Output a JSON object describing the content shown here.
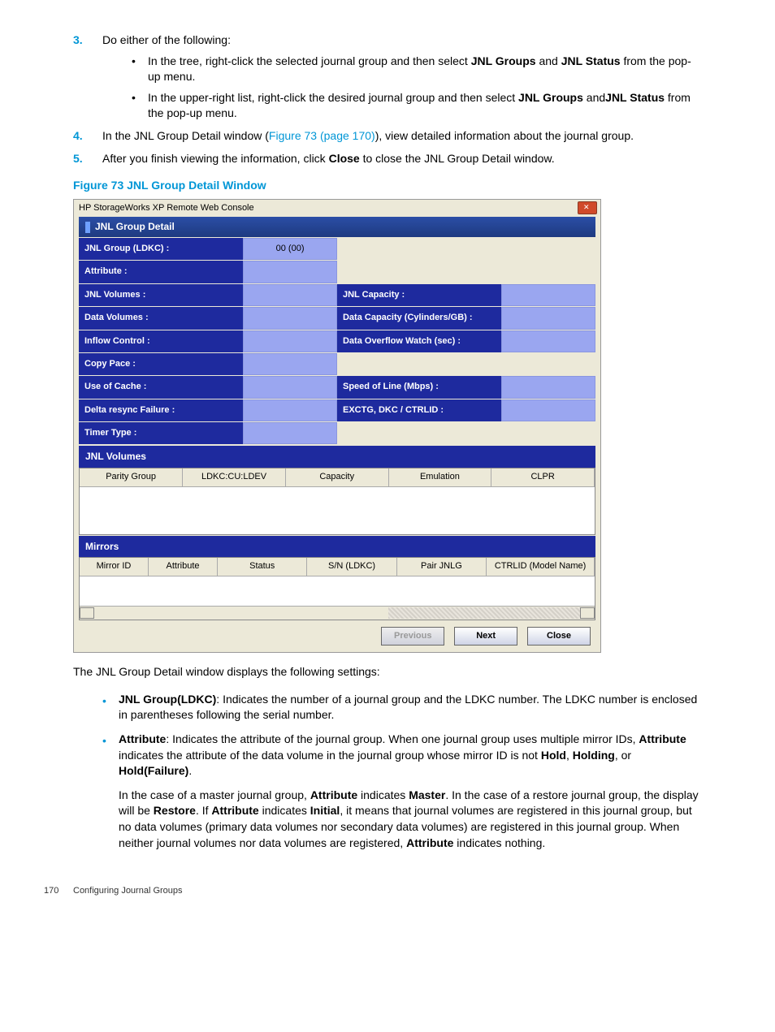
{
  "steps": {
    "s3": {
      "num": "3.",
      "text": "Do either of the following:",
      "sub1_pre": "In the tree, right-click the selected journal group and then select ",
      "sub1_b1": "JNL Groups",
      "sub1_mid": " and ",
      "sub1_b2": "JNL Status",
      "sub1_post": " from the pop-up menu.",
      "sub2_pre": "In the upper-right list, right-click the desired journal group and then select ",
      "sub2_b1": "JNL Groups",
      "sub2_mid": " and",
      "sub2_b2": "JNL Status",
      "sub2_post": " from the pop-up menu."
    },
    "s4": {
      "num": "4.",
      "pre": "In the JNL Group Detail window (",
      "link": "Figure 73 (page 170)",
      "post": "), view detailed information about the journal group."
    },
    "s5": {
      "num": "5.",
      "pre": "After you finish viewing the information, click ",
      "b": "Close",
      "post": " to close the JNL Group Detail window."
    }
  },
  "figure_title": "Figure 73 JNL Group Detail Window",
  "console": {
    "title": "HP StorageWorks XP Remote Web Console",
    "header": "JNL Group Detail",
    "rows": {
      "r1l": "JNL Group (LDKC) :",
      "r1v": "00 (00)",
      "r2l": "Attribute :",
      "r2v": "",
      "r3l": "JNL Volumes :",
      "r3v": "",
      "r3rl": "JNL Capacity :",
      "r3rv": "",
      "r4l": "Data Volumes :",
      "r4v": "",
      "r4rl": "Data Capacity (Cylinders/GB) :",
      "r4rv": "",
      "r5l": "Inflow Control :",
      "r5v": "",
      "r5rl": "Data Overflow Watch (sec) :",
      "r5rv": "",
      "r6l": "Copy Pace :",
      "r6v": "",
      "r7l": "Use of Cache :",
      "r7v": "",
      "r7rl": "Speed of Line (Mbps) :",
      "r7rv": "",
      "r8l": "Delta resync Failure :",
      "r8v": "",
      "r8rl": "EXCTG, DKC / CTRLID :",
      "r8rv": "",
      "r9l": "Timer Type :",
      "r9v": ""
    },
    "jnl_hdr": "JNL Volumes",
    "jnl_cols": [
      "Parity Group",
      "LDKC:CU:LDEV",
      "Capacity",
      "Emulation",
      "CLPR"
    ],
    "mir_hdr": "Mirrors",
    "mir_cols": [
      "Mirror ID",
      "Attribute",
      "Status",
      "S/N (LDKC)",
      "Pair JNLG",
      "CTRLID (Model Name)"
    ],
    "b_prev": "Previous",
    "b_next": "Next",
    "b_close": "Close"
  },
  "after": "The JNL Group Detail window displays the following settings:",
  "bullets": {
    "b1": {
      "b": "JNL Group(LDKC)",
      "t": ": Indicates the number of a journal group and the LDKC number. The LDKC number is enclosed in parentheses following the serial number."
    },
    "b2": {
      "b": "Attribute",
      "t1": ": Indicates the attribute of the journal group. When one journal group uses multiple mirror IDs, ",
      "b2": "Attribute",
      "t2": " indicates the attribute of the data volume in the journal group whose mirror ID is not ",
      "b3": "Hold",
      "t3": ", ",
      "b4": "Holding",
      "t4": ", or ",
      "b5": "Hold(Failure)",
      "t5": ".",
      "p2_pre": "In the case of a master journal group, ",
      "p2_b1": "Attribute",
      "p2_mid1": " indicates ",
      "p2_b2": "Master",
      "p2_mid2": ". In the case of a restore journal group, the display will be ",
      "p2_b3": "Restore",
      "p2_mid3": ". If ",
      "p2_b4": "Attribute",
      "p2_mid4": " indicates ",
      "p2_b5": "Initial",
      "p2_mid5": ", it means that journal volumes are registered in this journal group, but no data volumes (primary data volumes nor secondary data volumes) are registered in this journal group. When neither journal volumes nor data volumes are registered, ",
      "p2_b6": "Attribute",
      "p2_end": " indicates nothing."
    }
  },
  "footer": {
    "page": "170",
    "section": "Configuring Journal Groups"
  }
}
